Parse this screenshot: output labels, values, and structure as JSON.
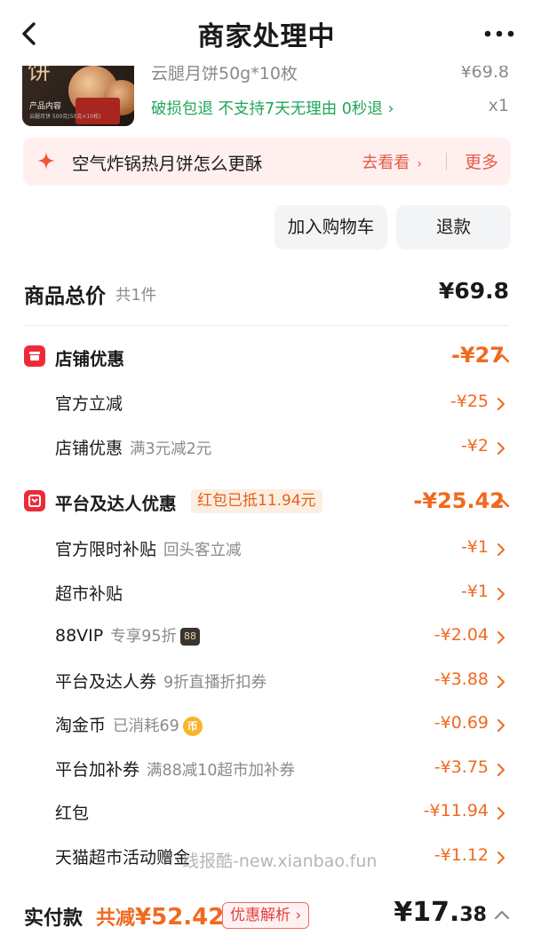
{
  "header": {
    "title": "商家处理中"
  },
  "product": {
    "image_text": {
      "logo": "饼",
      "line1": "产品内容",
      "line2": "云腿月饼 500克(50克×10枚)"
    },
    "name": "云腿月饼50g*10枚",
    "price": "¥69.8",
    "tags": "破损包退  不支持7天无理由  0秒退 ›",
    "qty": "x1"
  },
  "banner": {
    "text": "空气炸锅热月饼怎么更酥",
    "look": "去看看",
    "more": "更多"
  },
  "buttons": {
    "add_cart": "加入购物车",
    "refund": "退款"
  },
  "total": {
    "label": "商品总价",
    "count": "共1件",
    "amount": "¥69.8"
  },
  "store_discount": {
    "title": "店铺优惠",
    "amount": "-¥27",
    "items": [
      {
        "label": "官方立减",
        "sub": "",
        "amount": "-¥25"
      },
      {
        "label": "店铺优惠",
        "sub": "满3元减2元",
        "amount": "-¥2"
      }
    ]
  },
  "platform_discount": {
    "title": "平台及达人优惠",
    "chip": "红包已抵11.94元",
    "amount": "-¥25.42",
    "items": [
      {
        "label": "官方限时补贴",
        "sub": "回头客立减",
        "amount": "-¥1"
      },
      {
        "label": "超市补贴",
        "sub": "",
        "amount": "-¥1"
      },
      {
        "label": "88VIP",
        "sub": "专享95折",
        "badge": "88",
        "amount": "-¥2.04"
      },
      {
        "label": "平台及达人券",
        "sub": "9折直播折扣券",
        "amount": "-¥3.88"
      },
      {
        "label": "淘金币",
        "sub": "已消耗69",
        "coin": "币",
        "amount": "-¥0.69"
      },
      {
        "label": "平台加补券",
        "sub": "满88减10超市加补券",
        "amount": "-¥3.75"
      },
      {
        "label": "红包",
        "sub": "",
        "amount": "-¥11.94"
      },
      {
        "label": "天猫超市活动赠金",
        "sub": "",
        "amount": "-¥1.12"
      }
    ]
  },
  "watermark": "线报酷-new.xianbao.fun",
  "footer": {
    "paid_label": "实付款",
    "saved_prefix": "共减",
    "saved_amount": "¥52.42",
    "analysis": "优惠解析 ›",
    "final_main": "¥17.",
    "final_cents": "38"
  },
  "colors": {
    "accent": "#f06a1f",
    "green": "#21a65a",
    "red": "#ee2a3a",
    "pink_bg": "#fff0ef"
  }
}
